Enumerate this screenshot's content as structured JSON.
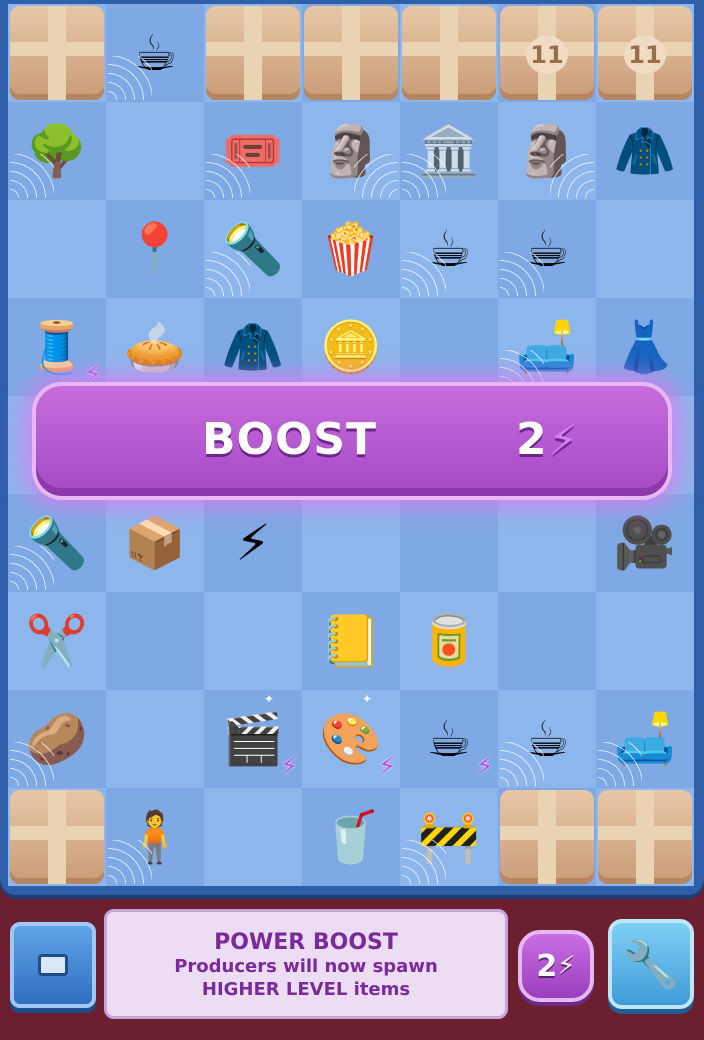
{
  "board": {
    "rows": [
      [
        {
          "t": "box"
        },
        {
          "t": "item",
          "icon": "☕",
          "web": true
        },
        {
          "t": "box"
        },
        {
          "t": "box"
        },
        {
          "t": "box"
        },
        {
          "t": "box",
          "badge": "11"
        },
        {
          "t": "box",
          "badge": "11"
        }
      ],
      [
        {
          "t": "item",
          "icon": "🌳",
          "web": true
        },
        {
          "t": "empty"
        },
        {
          "t": "item",
          "icon": "🎟️",
          "web": true
        },
        {
          "t": "item",
          "icon": "🗿",
          "web2": true
        },
        {
          "t": "item",
          "icon": "🏛️",
          "web": true
        },
        {
          "t": "item",
          "icon": "🗿",
          "web2": true
        },
        {
          "t": "item",
          "icon": "🧥"
        }
      ],
      [
        {
          "t": "empty"
        },
        {
          "t": "item",
          "icon": "📍"
        },
        {
          "t": "item",
          "icon": "🔦",
          "web": true
        },
        {
          "t": "item",
          "icon": "🍿"
        },
        {
          "t": "item",
          "icon": "☕",
          "web": true
        },
        {
          "t": "item",
          "icon": "☕",
          "web": true
        },
        {
          "t": "empty"
        }
      ],
      [
        {
          "t": "item",
          "icon": "🧵",
          "bolt": true
        },
        {
          "t": "item",
          "icon": "🥧"
        },
        {
          "t": "item",
          "icon": "🧥"
        },
        {
          "t": "item",
          "icon": "🪙"
        },
        {
          "t": "empty"
        },
        {
          "t": "item",
          "icon": "🛋️",
          "web": true
        },
        {
          "t": "item",
          "icon": "👗"
        }
      ],
      [
        {
          "t": "empty"
        },
        {
          "t": "empty"
        },
        {
          "t": "empty"
        },
        {
          "t": "empty"
        },
        {
          "t": "empty"
        },
        {
          "t": "empty"
        },
        {
          "t": "empty"
        }
      ],
      [
        {
          "t": "item",
          "icon": "🔦",
          "web": true
        },
        {
          "t": "item",
          "icon": "📦"
        },
        {
          "t": "item",
          "icon": "⚡"
        },
        {
          "t": "empty"
        },
        {
          "t": "empty"
        },
        {
          "t": "empty"
        },
        {
          "t": "item",
          "icon": "🎥"
        }
      ],
      [
        {
          "t": "item",
          "icon": "✂️"
        },
        {
          "t": "empty"
        },
        {
          "t": "empty"
        },
        {
          "t": "item",
          "icon": "📒"
        },
        {
          "t": "item",
          "icon": "🥫"
        },
        {
          "t": "empty"
        },
        {
          "t": "empty"
        }
      ],
      [
        {
          "t": "item",
          "icon": "🥔",
          "web": true
        },
        {
          "t": "empty"
        },
        {
          "t": "item",
          "icon": "🎬",
          "bolt": true,
          "sparkle": true
        },
        {
          "t": "item",
          "icon": "🎨",
          "bolt": true,
          "sparkle": true
        },
        {
          "t": "item",
          "icon": "☕",
          "bolt": true
        },
        {
          "t": "item",
          "icon": "☕",
          "web": true
        },
        {
          "t": "item",
          "icon": "🛋️",
          "web": true
        }
      ],
      [
        {
          "t": "box"
        },
        {
          "t": "item",
          "icon": "🧍",
          "web": true
        },
        {
          "t": "empty"
        },
        {
          "t": "item",
          "icon": "🥤"
        },
        {
          "t": "item",
          "icon": "🚧",
          "web": true
        },
        {
          "t": "box"
        },
        {
          "t": "box",
          "webbox": true
        }
      ]
    ]
  },
  "boost_banner": {
    "label": "BOOST",
    "cost": "2",
    "cost_icon": "⚡"
  },
  "info_panel": {
    "title": "POWER BOOST",
    "line1": "Producers will now spawn",
    "line2": "HIGHER LEVEL items"
  },
  "boost_button": {
    "value": "2",
    "icon": "⚡"
  },
  "drill_button": {
    "icon": "🔧"
  },
  "colors": {
    "boost_purple": "#b45ad3",
    "board_blue": "#8db6ec",
    "background": "#6b1f2f"
  }
}
